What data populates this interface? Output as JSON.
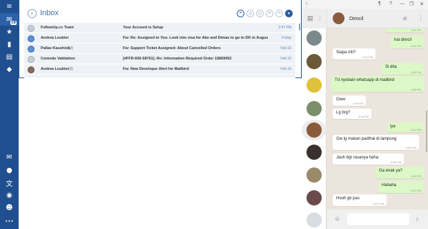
{
  "sidebar": {
    "items": [
      {
        "icon": "menu-icon",
        "glyph": "≡"
      },
      {
        "icon": "inbox-icon",
        "glyph": "✉",
        "badge": "18"
      },
      {
        "icon": "star-icon",
        "glyph": "★"
      },
      {
        "icon": "drafts-icon",
        "glyph": "▮"
      },
      {
        "icon": "archive-icon",
        "glyph": "▤"
      },
      {
        "icon": "tag-icon",
        "glyph": "◆"
      }
    ],
    "bottom_items": [
      {
        "icon": "mail-app-icon",
        "glyph": "✉"
      },
      {
        "icon": "chat-app-icon",
        "glyph": "●"
      },
      {
        "icon": "translate-app-icon",
        "glyph": "文"
      },
      {
        "icon": "whatsapp-app-icon",
        "glyph": "◉"
      },
      {
        "icon": "people-app-icon",
        "glyph": "☻"
      },
      {
        "icon": "more-icon",
        "glyph": "•••"
      }
    ]
  },
  "mail": {
    "title": "Inbox",
    "toolbar_glyphs": [
      "⌗",
      "◷",
      "◴",
      "↶",
      "↷",
      "▾"
    ],
    "rows": [
      {
        "sender": "FollowUp.cc Team",
        "count": "",
        "subject": "Your Account is Setup",
        "date": "2:47 PM",
        "avatar": "gray"
      },
      {
        "sender": "Andrea Loubier",
        "count": "",
        "subject": "Fw: Re: Assigned to You: Look into visa for Abe and Dimas to go to DK in August/July",
        "date": "Friday",
        "avatar": "blue"
      },
      {
        "sender": "Pallav Kaushish",
        "count": "(2)",
        "subject": "Fw: Support Ticket Assigned: About Cancelled Orders",
        "date": "Feb 16",
        "avatar": "blue"
      },
      {
        "sender": "Comodo Validation",
        "count": "",
        "subject": "[#FFR-600-58761]: Re: Information Required Order 15869092",
        "date": "Feb 16",
        "avatar": "gray"
      },
      {
        "sender": "Andrea Loubier",
        "count": "(2)",
        "subject": "Fw: New Developer Alert for Mailbird",
        "date": "Feb 16",
        "avatar": "photo"
      }
    ]
  },
  "whatsapp": {
    "titlebar": {
      "collapse": "›",
      "pin": "¶",
      "help": "?",
      "minimize": "—",
      "restore": "❐",
      "close": "✕"
    },
    "contact_name": "Dimcil",
    "messages": [
      {
        "dir": "out",
        "text": "",
        "time": "3:50 PM"
      },
      {
        "dir": "out",
        "text": "hai dimcil",
        "time": "4:03 PM"
      },
      {
        "dir": "in",
        "text": "Siapa nih?",
        "time": "4:44 PM"
      },
      {
        "dir": "out",
        "text": "Si dita",
        "time": "4:45 PM"
      },
      {
        "dir": "out",
        "text": "Td nyobain whatsapp di mailbird",
        "time": "4:45 PM"
      },
      {
        "dir": "in",
        "text": "Oww",
        "time": "4:45 PM"
      },
      {
        "dir": "in",
        "text": "Lg brg?",
        "time": "4:45 PM"
      },
      {
        "dir": "out",
        "text": "iya",
        "time": "5:54 PM"
      },
      {
        "dir": "in",
        "text": "Gw lg makan padthai di lampung",
        "time": "5:55 PM"
      },
      {
        "dir": "in",
        "text": "Jauh bgt rasanya haha",
        "time": "5:55 PM"
      },
      {
        "dir": "out",
        "text": "Ga enak ya?",
        "time": "6:06 PM"
      },
      {
        "dir": "out",
        "text": "Hahaha",
        "time": "6:07 PM"
      },
      {
        "dir": "in",
        "text": "Hooh gk pas",
        "time": "6:07 PM"
      }
    ],
    "icons": {
      "chats": "▤",
      "menu": "⋮",
      "attach": "⌀",
      "emoji": "☺",
      "mic": "♪"
    },
    "colors": {
      "outgoing": "#dcf8c6",
      "incoming": "#ffffff",
      "background": "#ece5dd"
    }
  }
}
